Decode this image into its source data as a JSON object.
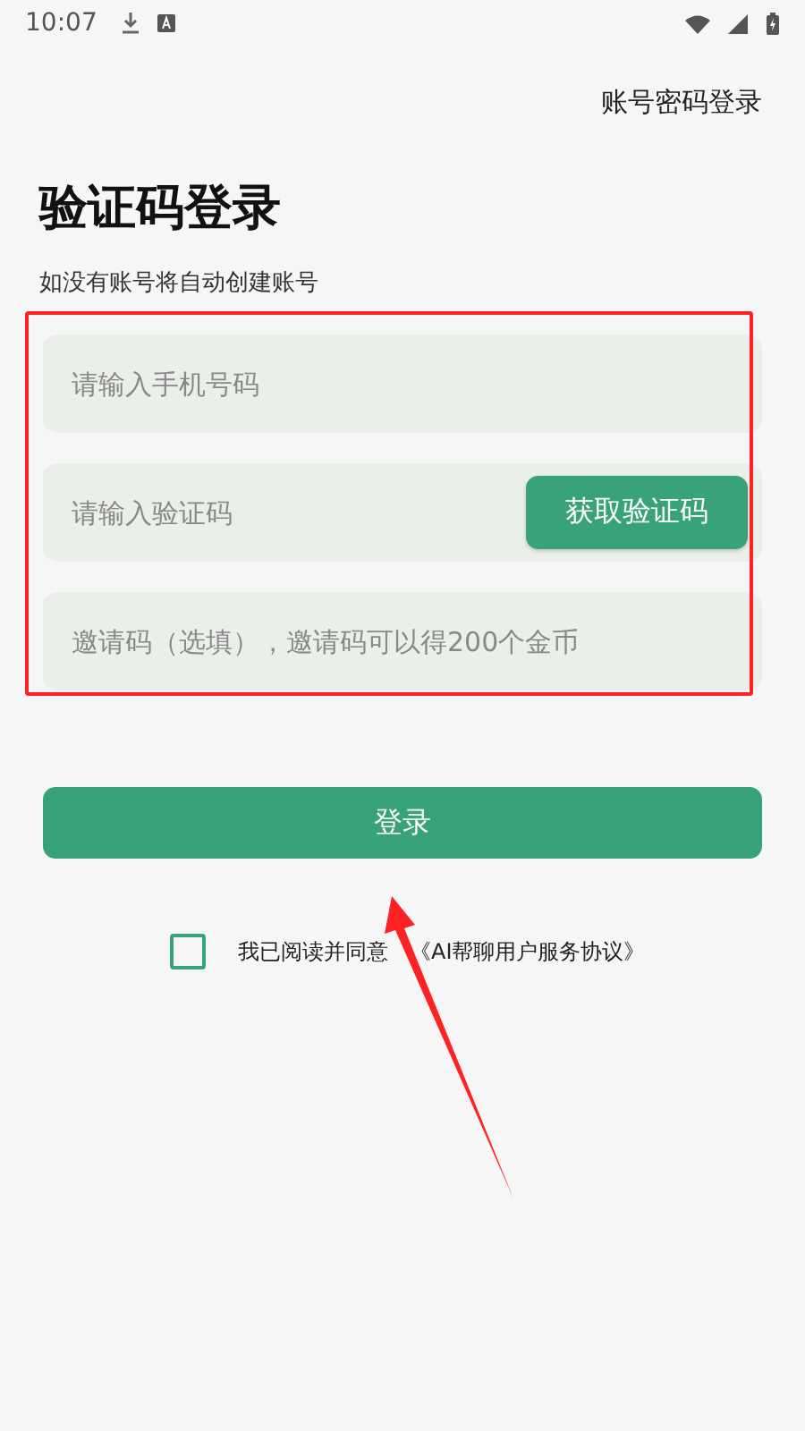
{
  "status_bar": {
    "time": "10:07"
  },
  "top_link": "账号密码登录",
  "title": "验证码登录",
  "subtitle": "如没有账号将自动创建账号",
  "fields": [
    {
      "placeholder": "请输入手机号码"
    },
    {
      "placeholder": "请输入验证码",
      "button": "获取验证码"
    },
    {
      "placeholder": "邀请码（选填），邀请码可以得200个金币"
    }
  ],
  "login_button": "登录",
  "agreement": {
    "checked": false,
    "text": "我已阅读并同意",
    "link": "《AI帮聊用户服务协议》"
  },
  "annotations": {
    "highlight_frame": true,
    "arrow": true
  }
}
